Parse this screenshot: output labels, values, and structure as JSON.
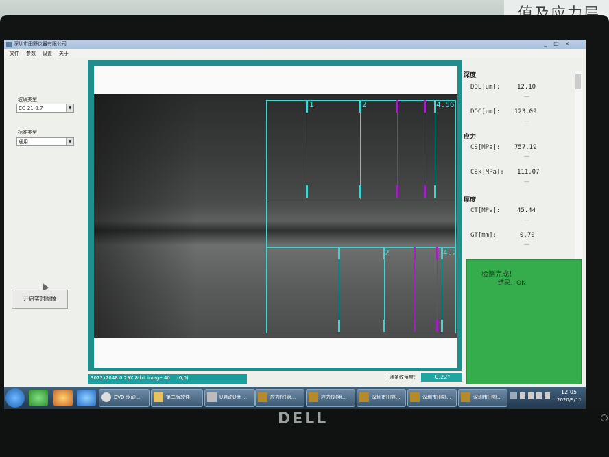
{
  "window": {
    "title": "深圳市田野仪器有限公司",
    "min_label": "_",
    "max_label": "□",
    "close_label": "×"
  },
  "menu": [
    "文件",
    "参数",
    "设置",
    "关于"
  ],
  "left_panel": {
    "glass_type_label": "玻璃类型",
    "glass_type_value": "CG-21-0.7",
    "standard_type_label": "标准类型",
    "standard_type_value": "通用",
    "live_button": "开启实时图像"
  },
  "image": {
    "fringe_labels_top": [
      "1",
      "2",
      "4.56"
    ],
    "fringe_labels_bottom": [
      "2",
      "4.2"
    ]
  },
  "status_bar": {
    "image_info": "3072x2048 0.29X 8-bit image 40",
    "coords": "(0,0)",
    "angle_label": "干涉条纹角度：",
    "angle_value": "-0.22°"
  },
  "measurements": {
    "depth": {
      "title": "深度",
      "items": [
        {
          "label": "DOL[um]:",
          "value": "12.10",
          "dash": "—"
        },
        {
          "label": "DOC[um]:",
          "value": "123.09",
          "dash": "—"
        }
      ]
    },
    "stress": {
      "title": "应力",
      "items": [
        {
          "label": "CS[MPa]:",
          "value": "757.19",
          "dash": "—"
        },
        {
          "label": "CSk[MPa]:",
          "value": "111.07",
          "dash": "—"
        }
      ]
    },
    "thickness": {
      "title": "厚度",
      "items": [
        {
          "label": "CT[MPa]:",
          "value": "45.44",
          "dash": "—"
        },
        {
          "label": "GT[mm]:",
          "value": "0.70",
          "dash": "—"
        }
      ]
    }
  },
  "result": {
    "line1": "检测完成！",
    "line2": "结果：OK"
  },
  "taskbar": {
    "buttons": [
      "DVD 驱动...",
      "第二版软件",
      "U启动U盘 ...",
      "应力仪(第...",
      "应力仪(第...",
      "深圳市田野...",
      "深圳市田野...",
      "深圳市田野..."
    ],
    "time": "12:05",
    "date": "2020/9/11"
  },
  "background": {
    "wall_text": "值及应力层",
    "brand": "DELL"
  },
  "colors": {
    "teal": "#1f8f8e",
    "result_green": "#35ad4c",
    "fringe_cyan": "#3fd3d0",
    "fringe_purple": "#a020c0"
  }
}
